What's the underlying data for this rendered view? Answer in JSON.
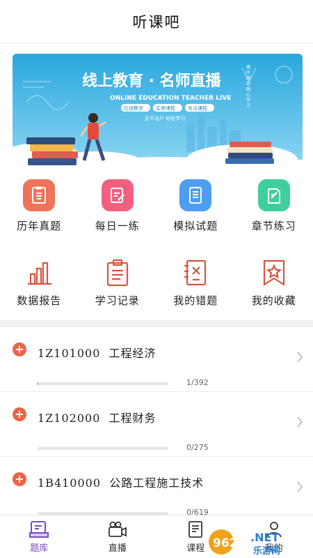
{
  "header": {
    "title": "听课吧"
  },
  "banner": {
    "title": "线上教育 · 名师直播",
    "subtitle": "ONLINE EDUCATION TEACHER LIVE",
    "chips": [
      "在线教学",
      "实用课程",
      "专注课程"
    ],
    "tagline": "足不出户 轻松学习",
    "side_text": "随 时 随 地 随 心 学 习"
  },
  "quick_entries": [
    {
      "label": "历年真题",
      "icon": "past-papers-icon",
      "color": "#f0735a"
    },
    {
      "label": "每日一练",
      "icon": "daily-practice-icon",
      "color": "#f3607f"
    },
    {
      "label": "模拟试题",
      "icon": "mock-exam-icon",
      "color": "#4e9df0"
    },
    {
      "label": "章节练习",
      "icon": "chapter-practice-icon",
      "color": "#3fcf9d"
    }
  ],
  "tools": [
    {
      "label": "数据报告",
      "icon": "bar-chart-icon"
    },
    {
      "label": "学习记录",
      "icon": "clipboard-icon"
    },
    {
      "label": "我的错题",
      "icon": "wrong-questions-icon"
    },
    {
      "label": "我的收藏",
      "icon": "bookmark-star-icon"
    }
  ],
  "accent_color": "#d9533f",
  "courses": [
    {
      "code": "1Z101000",
      "name": "工程经济",
      "progress_text": "1/392",
      "done": 1,
      "total": 392
    },
    {
      "code": "1Z102000",
      "name": "工程财务",
      "progress_text": "0/275",
      "done": 0,
      "total": 275
    },
    {
      "code": "1B410000",
      "name": "公路工程施工技术",
      "progress_text": "0/619",
      "done": 0,
      "total": 619
    }
  ],
  "tabbar": [
    {
      "label": "题库",
      "icon": "question-bank-icon",
      "active": true
    },
    {
      "label": "直播",
      "icon": "live-camera-icon",
      "active": false
    },
    {
      "label": "课程",
      "icon": "course-icon",
      "active": false
    },
    {
      "label": "我的",
      "icon": "profile-icon",
      "active": false
    }
  ],
  "watermark": {
    "brand": "962",
    "suffix": ".NET",
    "site": "乐游网"
  }
}
